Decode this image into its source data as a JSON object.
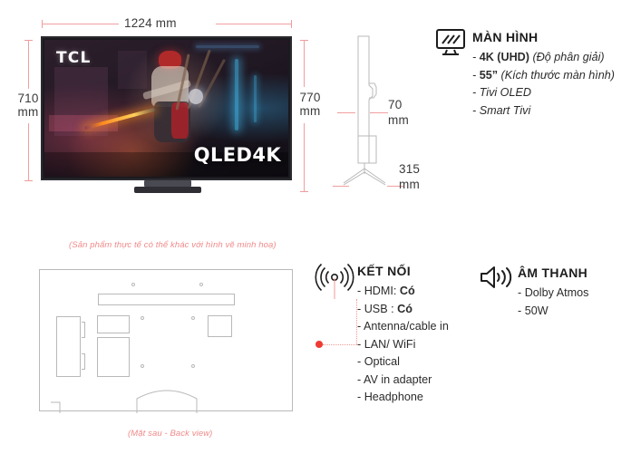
{
  "dimensions": {
    "width_label": "1224 mm",
    "height_left_value": "710",
    "height_left_unit": "mm",
    "height_right_value": "770",
    "height_right_unit": "mm",
    "depth_value": "70",
    "depth_unit": "mm",
    "stand_width_value": "315",
    "stand_width_unit": "mm"
  },
  "front_tv": {
    "brand_logo": "TCL",
    "panel_badge_main": "QLED",
    "panel_badge_sub": "4K"
  },
  "captions": {
    "front": "(Sản phẩm thực tế có thể khác với hình vẽ minh hoạ)",
    "back": "(Mặt sau - Back view)"
  },
  "specs": {
    "display": {
      "icon": "monitor-icon",
      "title": "MÀN HÌNH",
      "items": [
        {
          "dash": "- ",
          "strong": "4K (UHD)",
          "rest": " (Độ phân giải)"
        },
        {
          "dash": "- ",
          "strong": "55”",
          "rest": " (Kích thước màn hình)"
        },
        {
          "dash": "- ",
          "strong": "",
          "rest": "Tivi OLED"
        },
        {
          "dash": "- ",
          "strong": "",
          "rest": "Smart Tivi"
        }
      ]
    },
    "connectivity": {
      "icon": "signal-waves-icon",
      "title": "KẾT NỐI",
      "items": [
        {
          "dash": "- ",
          "label": "HDMI: ",
          "strong": "Có"
        },
        {
          "dash": "- ",
          "label": "USB : ",
          "strong": "Có"
        },
        {
          "dash": "- ",
          "label": "Antenna/cable in",
          "strong": ""
        },
        {
          "dash": "- ",
          "label": "LAN/ WiFi",
          "strong": ""
        },
        {
          "dash": "- ",
          "label": "Optical",
          "strong": ""
        },
        {
          "dash": "- ",
          "label": "AV in adapter",
          "strong": ""
        },
        {
          "dash": "- ",
          "label": "Headphone",
          "strong": ""
        }
      ]
    },
    "audio": {
      "icon": "speaker-icon",
      "title": "ÂM THANH",
      "items": [
        {
          "dash": "- ",
          "label": "Dolby Atmos"
        },
        {
          "dash": "- ",
          "label": "50W"
        }
      ]
    }
  },
  "colors": {
    "dimension_line": "#f2a0a0",
    "caption_text": "#f08a8a",
    "connector_dot": "#ee3b33",
    "outline": "#b9b9b9",
    "heading": "#1d1d1d"
  }
}
